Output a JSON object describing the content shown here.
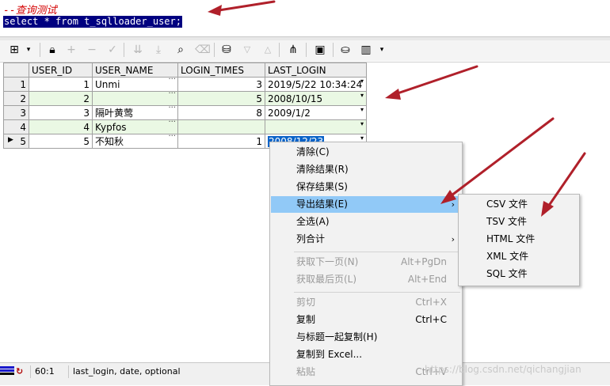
{
  "editor": {
    "comment": "--查询测试",
    "sql": "select * from t_sqlloader_user;"
  },
  "toolbar": {
    "icons": [
      "grid-icon",
      "lock-icon",
      "add-icon",
      "remove-icon",
      "post-icon",
      "next-icon",
      "last-icon",
      "find-icon",
      "clear-icon",
      "query-by-example-icon",
      "filter-down-icon",
      "filter-up-icon",
      "tree-icon",
      "save-icon",
      "export-icon",
      "chart-icon"
    ]
  },
  "grid": {
    "columns": [
      "USER_ID",
      "USER_NAME",
      "LOGIN_TIMES",
      "LAST_LOGIN"
    ],
    "rows": [
      {
        "rn": "1",
        "user_id": "1",
        "user_name": "Unmi",
        "login_times": "3",
        "last_login": "2019/5/22 10:34:24"
      },
      {
        "rn": "2",
        "user_id": "2",
        "user_name": "",
        "login_times": "5",
        "last_login": "2008/10/15"
      },
      {
        "rn": "3",
        "user_id": "3",
        "user_name": "隔叶黄莺",
        "login_times": "8",
        "last_login": "2009/1/2"
      },
      {
        "rn": "4",
        "user_id": "4",
        "user_name": "Kypfos",
        "login_times": "",
        "last_login": ""
      },
      {
        "rn": "5",
        "user_id": "5",
        "user_name": "不知秋",
        "login_times": "1",
        "last_login": "2008/12/23"
      }
    ],
    "ellipsis": "···",
    "dropdown_glyph": "▾",
    "row_pointer": "▶"
  },
  "context_menu": {
    "items": [
      {
        "label": "清除(C)",
        "shortcut": "",
        "disabled": false
      },
      {
        "label": "清除结果(R)",
        "shortcut": "",
        "disabled": false
      },
      {
        "label": "保存结果(S)",
        "shortcut": "",
        "disabled": false
      },
      {
        "label": "导出结果(E)",
        "shortcut": "",
        "disabled": false,
        "submenu": true,
        "highlighted": true
      },
      {
        "label": "全选(A)",
        "shortcut": "",
        "disabled": false
      },
      {
        "label": "列合计",
        "shortcut": "",
        "disabled": false,
        "submenu": true
      },
      {
        "label": "获取下一页(N)",
        "shortcut": "Alt+PgDn",
        "disabled": true
      },
      {
        "label": "获取最后页(L)",
        "shortcut": "Alt+End",
        "disabled": true
      },
      {
        "label": "剪切",
        "shortcut": "Ctrl+X",
        "disabled": true
      },
      {
        "label": "复制",
        "shortcut": "Ctrl+C",
        "disabled": false
      },
      {
        "label": "与标题一起复制(H)",
        "shortcut": "",
        "disabled": false
      },
      {
        "label": "复制到 Excel...",
        "shortcut": "",
        "disabled": false
      },
      {
        "label": "粘贴",
        "shortcut": "Ctrl+V",
        "disabled": true
      }
    ],
    "submenu_arrow": "›"
  },
  "export_submenu": {
    "items": [
      "CSV 文件",
      "TSV 文件",
      "HTML 文件",
      "XML 文件",
      "SQL 文件"
    ]
  },
  "status": {
    "position": "60:1",
    "message": "last_login, date, optional"
  },
  "watermark": "https://blog.csdn.net/qichangjian",
  "colors": {
    "accent_highlight": "#91c9f7",
    "sql_selection": "#000080",
    "comment": "#d40000",
    "alt_row": "#eaf8e4",
    "arrow": "#b0202a"
  }
}
